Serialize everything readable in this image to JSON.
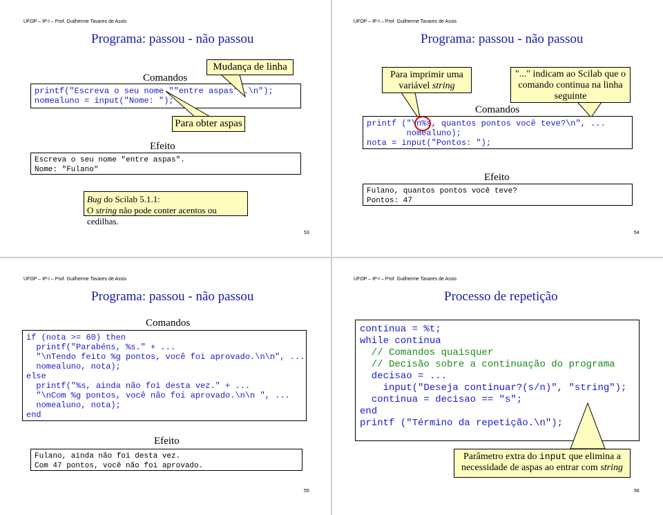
{
  "header": "UFOP – IP-I – Prof. Guilherme Tavares de Assis",
  "slide53": {
    "title": "Programa: passou - não passou",
    "comandos": "Comandos",
    "code": [
      "printf(\"Escreva o seu nome \"\"entre aspas\"\".\\n\");",
      "nomealuno = input(\"Nome: \");"
    ],
    "efeito": "Efeito",
    "output": [
      "Escreva o seu nome \"entre aspas\".",
      "Nome: \"Fulano\""
    ],
    "callout_linha": "Mudança de linha",
    "callout_aspas": "Para obter aspas",
    "bug_line1_italic": "Bug",
    "bug_line1_rest": " do Scilab 5.1.1:",
    "bug_line2_pre": "O ",
    "bug_line2_italic": "string",
    "bug_line2_rest": " não pode conter acentos ou cedilhas.",
    "page": "53"
  },
  "slide54": {
    "title": "Programa: passou - não passou",
    "callout_left_pre": "Para imprimir uma variável ",
    "callout_left_italic": "string",
    "callout_right": "\"...\" indicam ao Scilab que o comando continua na linha seguinte",
    "comandos": "Comandos",
    "code": [
      "printf (\"\\n%s, quantos pontos você teve?\\n\", ...",
      "        nomealuno);",
      "nota = input(\"Pontos: \");"
    ],
    "efeito": "Efeito",
    "output": [
      "Fulano, quantos pontos você teve?",
      "Pontos: 47"
    ],
    "page": "54"
  },
  "slide55": {
    "title": "Programa: passou - não passou",
    "comandos": "Comandos",
    "code": [
      "if (nota >= 60) then",
      "  printf(\"Parabéns, %s.\" + ...",
      "  \"\\nTendo feito %g pontos, você foi aprovado.\\n\\n\", ...",
      "  nomealuno, nota);",
      "else",
      "  printf(\"%s, ainda não foi desta vez.\" + ...",
      "  \"\\nCom %g pontos, você não foi aprovado.\\n\\n \", ...",
      "  nomealuno, nota);",
      "end"
    ],
    "efeito": "Efeito",
    "output": [
      "Fulano, ainda não foi desta vez.",
      "Com 47 pontos, você não foi aprovado."
    ],
    "page": "55"
  },
  "slide56": {
    "title": "Processo de repetição",
    "code": [
      "continua = %t;",
      "while continua",
      "  // Comandos quaisquer",
      "",
      "  // Decisão sobre a continuação do programa",
      "  decisao = ...",
      "    input(\"Deseja continuar?(s/n)\", \"string\");",
      "  continua = decisao == \"s\";",
      "end",
      "printf (\"Término da repetição.\\n\");"
    ],
    "callout_pre": "Parâmetro extra do ",
    "callout_code": "input",
    "callout_mid": " que elimina a necessidade de aspas ao entrar com ",
    "callout_italic": "string",
    "page": "56"
  },
  "colors": {
    "title": "#1a1aa8",
    "code": "#1a1acc",
    "comment": "#1a8a1a",
    "callout": "#fffcc0",
    "circle": "#cc0000"
  }
}
